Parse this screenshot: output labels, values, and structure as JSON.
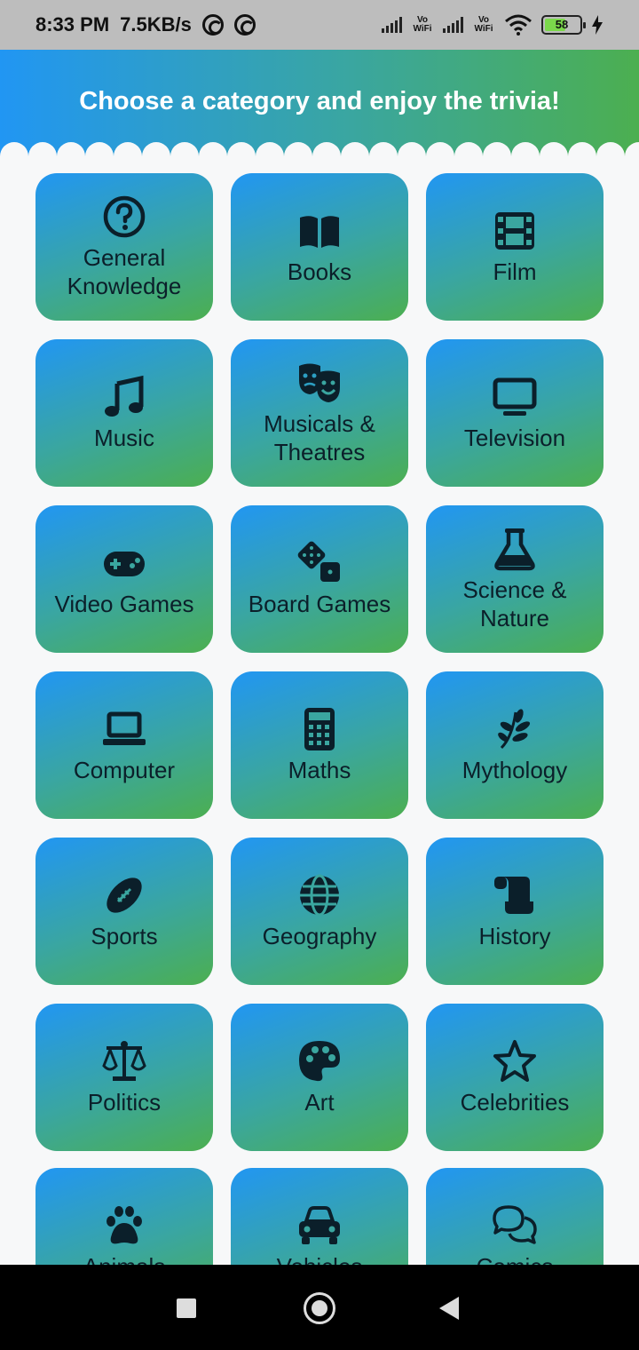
{
  "status_bar": {
    "time": "8:33 PM",
    "speed": "7.5KB/s",
    "vowifi_1": "Vo WiFi",
    "vowifi_2": "Vo WiFi",
    "battery": "58"
  },
  "header": {
    "title": "Choose a category and enjoy the trivia!"
  },
  "colors": {
    "gradient_start": "#2196f3",
    "gradient_end": "#4caf50",
    "icon_color": "#0b1f2a"
  },
  "categories": [
    {
      "label": "General Knowledge",
      "icon": "question-circle-icon"
    },
    {
      "label": "Books",
      "icon": "book-icon"
    },
    {
      "label": "Film",
      "icon": "film-icon"
    },
    {
      "label": "Music",
      "icon": "music-note-icon"
    },
    {
      "label": "Musicals & Theatres",
      "icon": "theater-masks-icon"
    },
    {
      "label": "Television",
      "icon": "tv-icon"
    },
    {
      "label": "Video Games",
      "icon": "gamepad-icon"
    },
    {
      "label": "Board Games",
      "icon": "dice-icon"
    },
    {
      "label": "Science & Nature",
      "icon": "flask-icon"
    },
    {
      "label": "Computer",
      "icon": "laptop-icon"
    },
    {
      "label": "Maths",
      "icon": "calculator-icon"
    },
    {
      "label": "Mythology",
      "icon": "laurel-icon"
    },
    {
      "label": "Sports",
      "icon": "football-icon"
    },
    {
      "label": "Geography",
      "icon": "globe-icon"
    },
    {
      "label": "History",
      "icon": "scroll-icon"
    },
    {
      "label": "Politics",
      "icon": "scale-icon"
    },
    {
      "label": "Art",
      "icon": "palette-icon"
    },
    {
      "label": "Celebrities",
      "icon": "star-icon"
    },
    {
      "label": "Animals",
      "icon": "paw-icon"
    },
    {
      "label": "Vehicles",
      "icon": "car-icon"
    },
    {
      "label": "Comics",
      "icon": "comments-icon"
    }
  ]
}
